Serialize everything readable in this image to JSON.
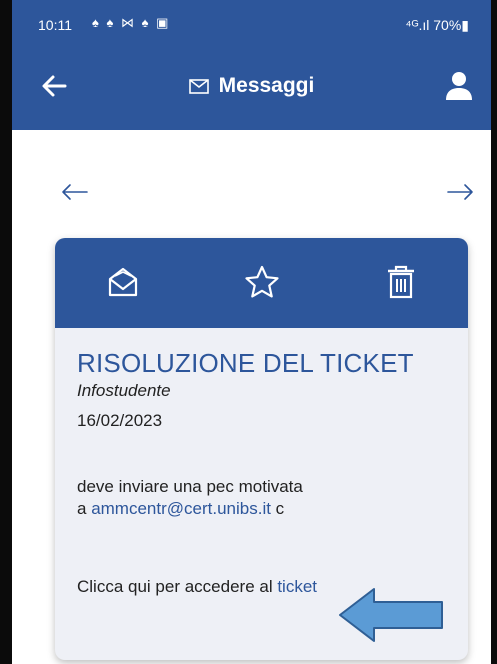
{
  "statusbar": {
    "time": "10:11",
    "notifications": "♠ ♠ ⋈ ♠ ▣",
    "system": "⁴ᴳ.ıl 70%▮"
  },
  "appbar": {
    "title": "Messaggi",
    "back_icon": "arrow-left-icon",
    "title_icon": "envelope-icon",
    "user_icon": "user-icon"
  },
  "navigation": {
    "prev_icon": "arrow-left-icon",
    "next_icon": "arrow-right-icon"
  },
  "message": {
    "actions": [
      "envelope-open-icon",
      "star-icon",
      "trash-icon"
    ],
    "title": "RISOLUZIONE DEL TICKET",
    "sender": "Infostudente",
    "date": "16/02/2023",
    "body_line1": "deve inviare una pec motivata",
    "body_line2_prefix": "a ",
    "email": "ammcentr@cert.unibs.it",
    "body_line2_suffix": " c",
    "link_prefix": "Clicca qui per accedere al ",
    "link_text": "ticket"
  },
  "colors": {
    "primary": "#2d569b",
    "card_bg": "#eef0f6",
    "callout_arrow": "#5b9bd5"
  }
}
